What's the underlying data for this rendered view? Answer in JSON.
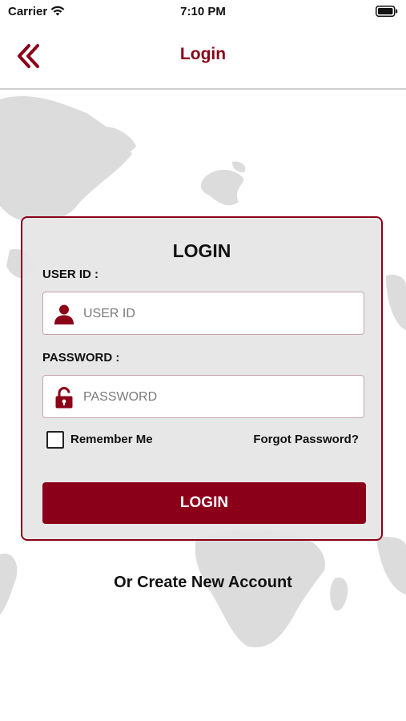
{
  "status_bar": {
    "carrier": "Carrier",
    "time": "7:10 PM",
    "wifi_icon": "wifi-icon",
    "battery_icon": "battery-icon"
  },
  "nav": {
    "title": "Login",
    "back_icon": "double-chevron-left-icon"
  },
  "form": {
    "heading": "LOGIN",
    "user_label": "USER ID :",
    "user_placeholder": "USER ID",
    "user_icon": "person-icon",
    "password_label": "PASSWORD :",
    "password_placeholder": "PASSWORD",
    "password_icon": "unlocked-padlock-icon",
    "remember_label": "Remember Me",
    "remember_checked": false,
    "forgot_label": "Forgot Password?",
    "submit_label": "LOGIN"
  },
  "footer": {
    "create_account": "Or Create New Account"
  },
  "colors": {
    "accent": "#8b0018",
    "card_bg": "#e5e5e5",
    "map": "#dcdcdc"
  }
}
